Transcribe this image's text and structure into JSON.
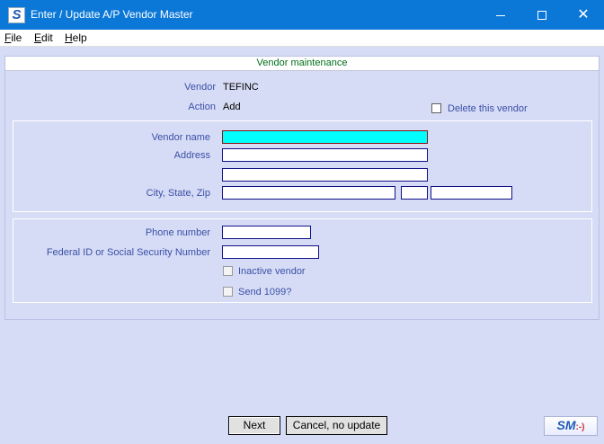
{
  "window": {
    "title": "Enter / Update A/P Vendor Master",
    "app_icon_letter": "S"
  },
  "menu": [
    {
      "label": "File",
      "key": "F",
      "rest": "ile"
    },
    {
      "label": "Edit",
      "key": "E",
      "rest": "dit"
    },
    {
      "label": "Help",
      "key": "H",
      "rest": "elp"
    }
  ],
  "header": {
    "title": "Vendor maintenance"
  },
  "vendor": {
    "label": "Vendor",
    "value": "TEFINC",
    "action_label": "Action",
    "action_value": "Add",
    "delete_label": "Delete this vendor",
    "delete_checked": false
  },
  "address_group": {
    "name_label": "Vendor name",
    "name_value": "",
    "address_label": "Address",
    "address1": "",
    "address2": "",
    "city_label": "City, State, Zip",
    "city": "",
    "state": "",
    "zip": ""
  },
  "details_group": {
    "phone_label": "Phone number",
    "phone": "",
    "fedid_label": "Federal ID or Social Security Number",
    "fedid": "",
    "inactive_label": "Inactive vendor",
    "send1099_label": "Send 1099?"
  },
  "buttons": {
    "next": "Next",
    "cancel": "Cancel, no update"
  },
  "logo": {
    "text": "SM",
    "face": ":-)"
  },
  "colors": {
    "titlebar": "#0b78d7",
    "background": "#d6dcf5",
    "active_field": "#00ffff",
    "label": "#3b4fa8",
    "header_text": "#00701a"
  }
}
